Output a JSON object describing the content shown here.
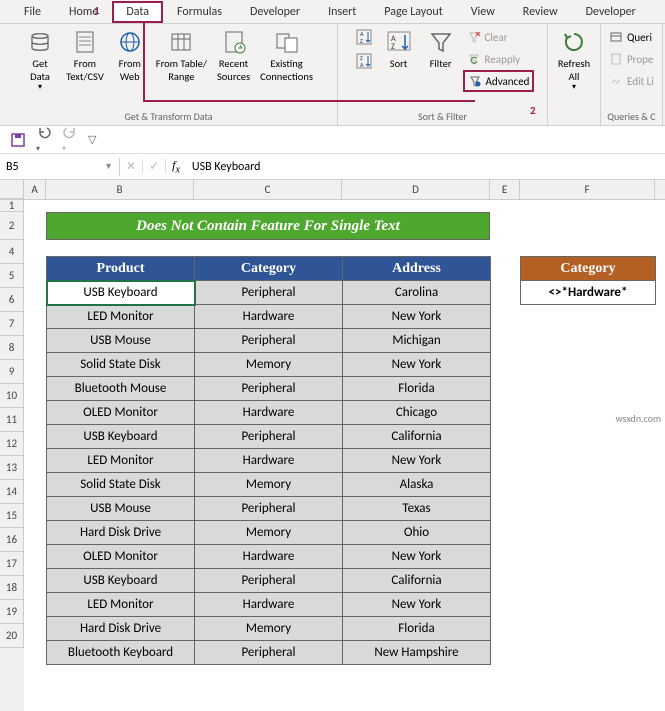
{
  "tabs": [
    "File",
    "Home",
    "Data",
    "Formulas",
    "Developer",
    "Insert",
    "Page Layout",
    "View",
    "Review",
    "Developer"
  ],
  "active_tab_index": 2,
  "ribbon": {
    "get_transform": {
      "title": "Get & Transform Data",
      "buttons": [
        {
          "label": "Get\nData",
          "name": "get-data-btn"
        },
        {
          "label": "From\nText/CSV",
          "name": "from-text-csv-btn"
        },
        {
          "label": "From\nWeb",
          "name": "from-web-btn"
        },
        {
          "label": "From Table/\nRange",
          "name": "from-table-range-btn"
        },
        {
          "label": "Recent\nSources",
          "name": "recent-sources-btn"
        },
        {
          "label": "Existing\nConnections",
          "name": "existing-connections-btn"
        }
      ]
    },
    "sort_filter": {
      "title": "Sort & Filter",
      "sort_az": "A→Z",
      "sort_za": "Z→A",
      "sort": "Sort",
      "filter": "Filter",
      "clear": "Clear",
      "reapply": "Reapply",
      "advanced": "Advanced"
    },
    "refresh": {
      "label": "Refresh\nAll"
    },
    "queries": {
      "title": "Queries & C",
      "queries": "Queri",
      "properties": "Prope",
      "edit_links": "Edit Li"
    }
  },
  "steps": {
    "one": "1",
    "two": "2"
  },
  "qat": {
    "save": "💾",
    "undo": "↶",
    "redo": "↷"
  },
  "name_box": "B5",
  "formula_value": "USB Keyboard",
  "columns": [
    "A",
    "B",
    "C",
    "D",
    "E",
    "F"
  ],
  "rows": [
    "1",
    "2",
    "4",
    "5",
    "6",
    "7",
    "8",
    "9",
    "10",
    "11",
    "12",
    "13",
    "14",
    "15",
    "16",
    "17",
    "18",
    "19",
    "20"
  ],
  "title_banner": "Does Not Contain Feature For Single Text",
  "table": {
    "headers": [
      "Product",
      "Category",
      "Address"
    ],
    "rows": [
      [
        "USB Keyboard",
        "Peripheral",
        "Carolina"
      ],
      [
        "LED Monitor",
        "Hardware",
        "New York"
      ],
      [
        "USB Mouse",
        "Peripheral",
        "Michigan"
      ],
      [
        "Solid State Disk",
        "Memory",
        "New York"
      ],
      [
        "Bluetooth Mouse",
        "Peripheral",
        "Florida"
      ],
      [
        "OLED Monitor",
        "Hardware",
        "Chicago"
      ],
      [
        "USB Keyboard",
        "Peripheral",
        "California"
      ],
      [
        "LED Monitor",
        "Hardware",
        "New York"
      ],
      [
        "Solid State Disk",
        "Memory",
        "Alaska"
      ],
      [
        "USB Mouse",
        "Peripheral",
        "Texas"
      ],
      [
        "Hard Disk Drive",
        "Memory",
        "Ohio"
      ],
      [
        "OLED Monitor",
        "Hardware",
        "New York"
      ],
      [
        "USB Keyboard",
        "Peripheral",
        "California"
      ],
      [
        "LED Monitor",
        "Hardware",
        "New York"
      ],
      [
        "Hard Disk Drive",
        "Memory",
        "Florida"
      ],
      [
        "Bluetooth Keyboard",
        "Peripheral",
        "New Hampshire"
      ]
    ]
  },
  "criteria": {
    "header": "Category",
    "value": "<>*Hardware*"
  },
  "watermark": "wsxdn.com"
}
